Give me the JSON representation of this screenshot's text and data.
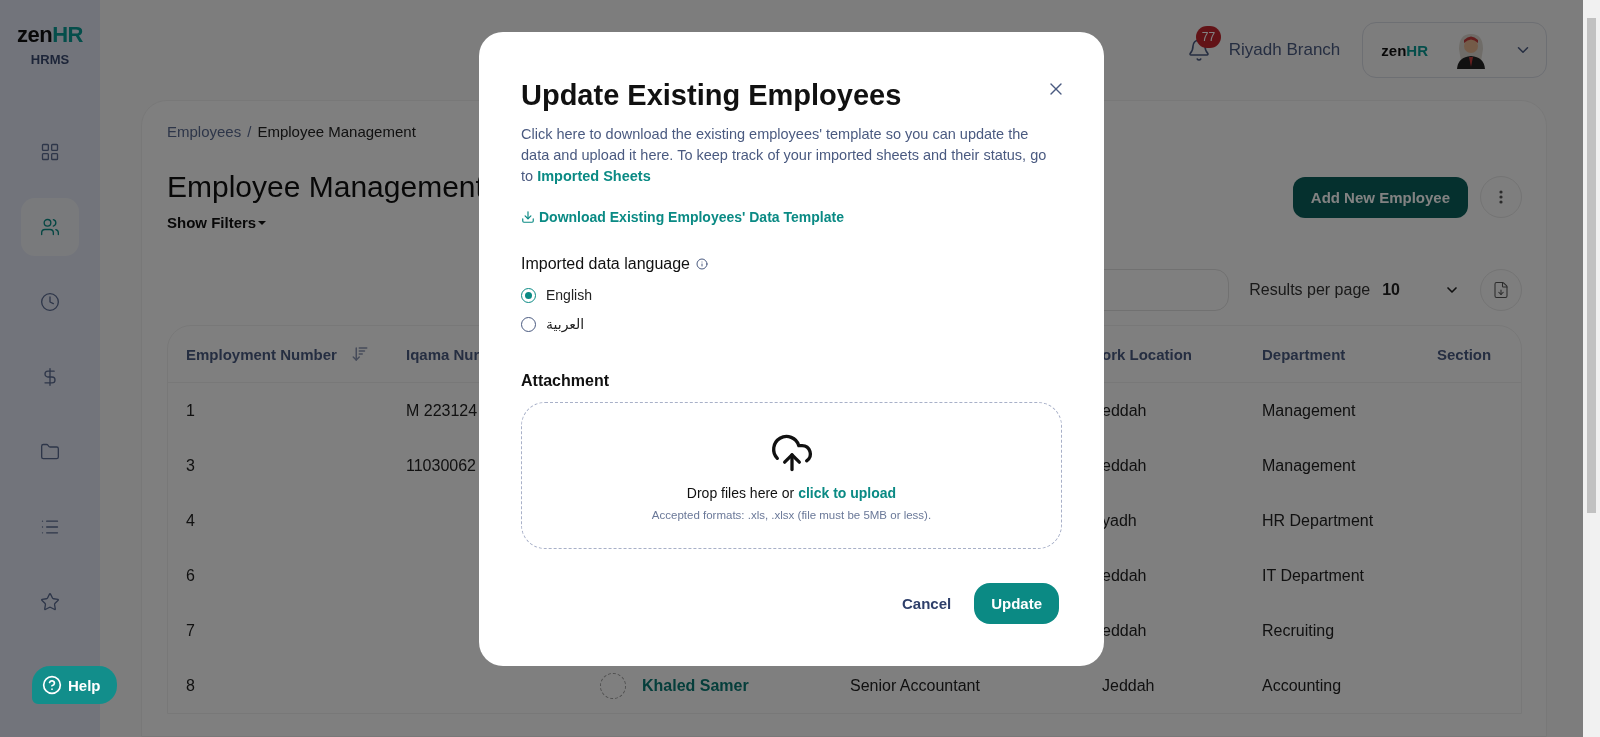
{
  "brand": {
    "name_prefix": "zen",
    "name_suffix": "HR",
    "product": "HRMS"
  },
  "sidebar": {
    "items": [
      {
        "kind": "grid",
        "selected": false
      },
      {
        "kind": "people",
        "selected": true
      },
      {
        "kind": "clock",
        "selected": false
      },
      {
        "kind": "dollar",
        "selected": false
      },
      {
        "kind": "folder",
        "selected": false
      },
      {
        "kind": "list",
        "selected": false
      },
      {
        "kind": "star",
        "selected": false
      }
    ]
  },
  "header": {
    "notifications": "77",
    "branch": "Riyadh Branch",
    "profile": {
      "logo_prefix": "zen",
      "logo_suffix": "HR"
    }
  },
  "breadcrumb": {
    "items": [
      "Employees",
      "Employee Management"
    ],
    "separator": "/"
  },
  "page_title": "Employee Management",
  "filters_toggle": "Show Filters",
  "primary_action": "Add New Employee",
  "results_per_page": {
    "label": "Results per page",
    "value": "10"
  },
  "table": {
    "columns": [
      {
        "label": "Employment Number",
        "kind": "sorted"
      },
      {
        "label": "Iqama Nur",
        "kind": "plain"
      },
      {
        "kind": "plain"
      },
      {
        "kind": "plain"
      },
      {
        "label": "ork Location",
        "kind": "plain"
      },
      {
        "label": "Department",
        "kind": "plain"
      },
      {
        "label": "Section",
        "kind": "plain"
      }
    ],
    "rows": [
      {
        "cells": [
          "1",
          "M 223124",
          null,
          null,
          "eddah",
          "Management",
          null
        ]
      },
      {
        "cells": [
          "3",
          "11030062",
          null,
          null,
          "eddah",
          "Management",
          null
        ]
      },
      {
        "cells": [
          "4",
          null,
          null,
          null,
          "yadh",
          "HR Department",
          null
        ]
      },
      {
        "cells": [
          "6",
          null,
          null,
          null,
          "eddah",
          "IT Department",
          null
        ]
      },
      {
        "cells": [
          "7",
          null,
          null,
          null,
          "eddah",
          "Recruiting",
          null
        ]
      },
      {
        "cells": [
          "8",
          null,
          "Khaled Samer",
          "Senior Accountant",
          "Jeddah",
          "Accounting",
          null
        ]
      }
    ]
  },
  "help": {
    "label": "Help"
  },
  "modal": {
    "title": "Update Existing Employees",
    "description": "Click here to download the existing employees' template so you can update the data and upload it here. To keep track of your imported sheets and their status, go to",
    "description_link": "Imported Sheets",
    "download_link": "Download Existing Employees' Data Template",
    "language": {
      "label": "Imported data language",
      "options": [
        {
          "label": "English",
          "selected": true
        },
        {
          "label": "العربية",
          "selected": false
        }
      ]
    },
    "attachment": {
      "label": "Attachment",
      "drop_text": "Drop files here or",
      "upload_link": "click to upload",
      "hint": "Accepted formats: .xls, .xlsx (file must be 5MB or less)."
    },
    "buttons": {
      "cancel": "Cancel",
      "submit": "Update"
    }
  }
}
